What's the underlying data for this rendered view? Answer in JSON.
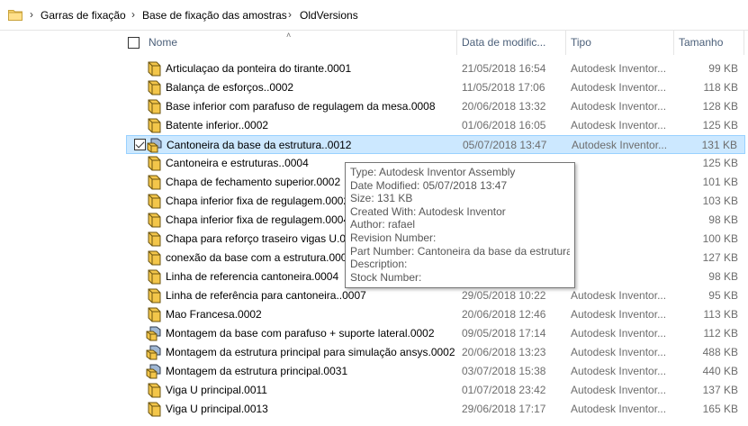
{
  "breadcrumb": {
    "items": [
      "Garras de fixação",
      "Base de fixação das amostras",
      "OldVersions"
    ],
    "separator": "›"
  },
  "columns": {
    "name": "Nome",
    "date": "Data de modific...",
    "type": "Tipo",
    "size": "Tamanho"
  },
  "files": [
    {
      "name": "Articulaçao da ponteira do tirante.0001",
      "date": "21/05/2018 16:54",
      "type": "Autodesk Inventor...",
      "size": "99 KB",
      "icon": "part-icon"
    },
    {
      "name": "Balança de esforços..0002",
      "date": "11/05/2018 17:06",
      "type": "Autodesk Inventor...",
      "size": "118 KB",
      "icon": "part-icon"
    },
    {
      "name": "Base inferior com parafuso de regulagem da mesa.0008",
      "date": "20/06/2018 13:32",
      "type": "Autodesk Inventor...",
      "size": "128 KB",
      "icon": "part-icon"
    },
    {
      "name": "Batente inferior..0002",
      "date": "01/06/2018 16:05",
      "type": "Autodesk Inventor...",
      "size": "125 KB",
      "icon": "part-icon"
    },
    {
      "name": "Cantoneira da base da estrutura..0012",
      "date": "05/07/2018 13:47",
      "type": "Autodesk Inventor...",
      "size": "131 KB",
      "icon": "assembly-icon",
      "selected": true
    },
    {
      "name": "Cantoneira e estruturas..0004",
      "date": "",
      "type": "",
      "size": "125 KB",
      "icon": "part-icon"
    },
    {
      "name": "Chapa de fechamento superior.0002",
      "date": "",
      "type": "",
      "size": "101 KB",
      "icon": "part-icon"
    },
    {
      "name": "Chapa inferior fixa de regulagem.0002",
      "date": "",
      "type": "",
      "size": "103 KB",
      "icon": "part-icon"
    },
    {
      "name": "Chapa inferior fixa de regulagem.0004",
      "date": "",
      "type": "",
      "size": "98 KB",
      "icon": "part-icon"
    },
    {
      "name": "Chapa para reforço traseiro vigas U.00",
      "date": "",
      "type": "",
      "size": "100 KB",
      "icon": "part-icon"
    },
    {
      "name": "conexão da base com a estrutura.0007",
      "date": "",
      "type": "",
      "size": "127 KB",
      "icon": "part-icon"
    },
    {
      "name": "Linha de referencia cantoneira.0004",
      "date": "",
      "type": "",
      "size": "98 KB",
      "icon": "part-icon"
    },
    {
      "name": "Linha de referência para cantoneira..0007",
      "date": "29/05/2018 10:22",
      "type": "Autodesk Inventor...",
      "size": "95 KB",
      "icon": "part-icon"
    },
    {
      "name": "Mao Francesa.0002",
      "date": "20/06/2018 12:46",
      "type": "Autodesk Inventor...",
      "size": "113 KB",
      "icon": "part-icon"
    },
    {
      "name": "Montagem da base com parafuso + suporte lateral.0002",
      "date": "09/05/2018 17:14",
      "type": "Autodesk Inventor...",
      "size": "112 KB",
      "icon": "assembly-icon"
    },
    {
      "name": "Montagem da estrutura principal para simulação ansys.0002",
      "date": "20/06/2018 13:23",
      "type": "Autodesk Inventor...",
      "size": "488 KB",
      "icon": "assembly-icon"
    },
    {
      "name": "Montagem da estrutura principal.0031",
      "date": "03/07/2018 15:38",
      "type": "Autodesk Inventor...",
      "size": "440 KB",
      "icon": "assembly-icon"
    },
    {
      "name": "Viga U principal.0011",
      "date": "01/07/2018 23:42",
      "type": "Autodesk Inventor...",
      "size": "137 KB",
      "icon": "part-icon"
    },
    {
      "name": "Viga U principal.0013",
      "date": "29/06/2018 17:17",
      "type": "Autodesk Inventor...",
      "size": "165 KB",
      "icon": "part-icon"
    }
  ],
  "tooltip": {
    "lines": [
      "Type: Autodesk Inventor Assembly",
      "Date Modified: 05/07/2018 13:47",
      "Size: 131 KB",
      "Created With: Autodesk Inventor",
      "Author: rafael",
      "Revision Number:",
      "Part Number: Cantoneira da base da estrutura.",
      "Description:",
      "Stock Number:"
    ]
  },
  "colors": {
    "selection_bg": "#cce8ff",
    "selection_border": "#99d1ff",
    "header_text": "#4c607a",
    "secondary_text": "#6d6d6d",
    "part_icon_fill": "#f3c64a"
  }
}
